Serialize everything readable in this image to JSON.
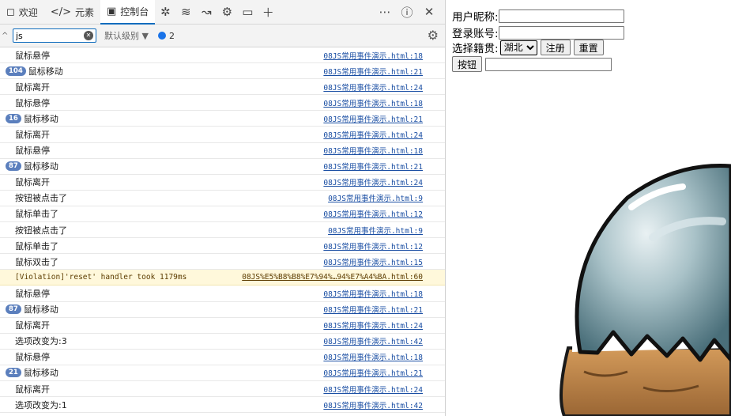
{
  "devtools": {
    "tabs": [
      {
        "label": "欢迎",
        "icon": "welcome-icon"
      },
      {
        "label": "元素",
        "icon": "elements-icon"
      },
      {
        "label": "控制台",
        "icon": "console-icon",
        "active": true
      }
    ],
    "filter": {
      "value": "js",
      "level_label": "默认级别 ▼",
      "issue_count": "2"
    },
    "console_rows": [
      {
        "badge": "",
        "msg": "鼠标悬停",
        "src": "08JS常用事件演示.html:18"
      },
      {
        "badge": "104",
        "msg": "鼠标移动",
        "src": "08JS常用事件演示.html:21"
      },
      {
        "badge": "",
        "msg": "鼠标离开",
        "src": "08JS常用事件演示.html:24"
      },
      {
        "badge": "",
        "msg": "鼠标悬停",
        "src": "08JS常用事件演示.html:18"
      },
      {
        "badge": "16",
        "msg": "鼠标移动",
        "src": "08JS常用事件演示.html:21"
      },
      {
        "badge": "",
        "msg": "鼠标离开",
        "src": "08JS常用事件演示.html:24"
      },
      {
        "badge": "",
        "msg": "鼠标悬停",
        "src": "08JS常用事件演示.html:18"
      },
      {
        "badge": "87",
        "msg": "鼠标移动",
        "src": "08JS常用事件演示.html:21"
      },
      {
        "badge": "",
        "msg": "鼠标离开",
        "src": "08JS常用事件演示.html:24"
      },
      {
        "badge": "",
        "msg": "按钮被点击了",
        "src": "08JS常用事件演示.html:9"
      },
      {
        "badge": "",
        "msg": "鼠标单击了",
        "src": "08JS常用事件演示.html:12"
      },
      {
        "badge": "",
        "msg": "按钮被点击了",
        "src": "08JS常用事件演示.html:9"
      },
      {
        "badge": "",
        "msg": "鼠标单击了",
        "src": "08JS常用事件演示.html:12"
      },
      {
        "badge": "",
        "msg": "鼠标双击了",
        "src": "08JS常用事件演示.html:15"
      },
      {
        "badge": "",
        "msg": "[Violation]'reset' handler took 1179ms",
        "src": "08JS%E5%B8%B8%E7%94%…94%E7%A4%BA.html:60",
        "warning": true
      },
      {
        "badge": "",
        "msg": "鼠标悬停",
        "src": "08JS常用事件演示.html:18"
      },
      {
        "badge": "87",
        "msg": "鼠标移动",
        "src": "08JS常用事件演示.html:21"
      },
      {
        "badge": "",
        "msg": "鼠标离开",
        "src": "08JS常用事件演示.html:24"
      },
      {
        "badge": "",
        "msg": "选项改变为:3",
        "src": "08JS常用事件演示.html:42"
      },
      {
        "badge": "",
        "msg": "鼠标悬停",
        "src": "08JS常用事件演示.html:18"
      },
      {
        "badge": "21",
        "msg": "鼠标移动",
        "src": "08JS常用事件演示.html:21"
      },
      {
        "badge": "",
        "msg": "鼠标离开",
        "src": "08JS常用事件演示.html:24"
      },
      {
        "badge": "",
        "msg": "选项改变为:1",
        "src": "08JS常用事件演示.html:42"
      }
    ]
  },
  "page": {
    "nickname_label": "用户昵称:",
    "account_label": "登录账号:",
    "origin_label": "选择籍贯:",
    "origin_selected": "湖北",
    "register_button": "注册",
    "reset_button": "重置",
    "plain_button": "按钮",
    "nickname_value": "",
    "account_value": "",
    "extra_value": ""
  },
  "colors": {
    "accent": "#0f6cbd",
    "badge": "#5b7fbd",
    "link": "#1a4ea3",
    "warning_bg": "#fff8db"
  }
}
